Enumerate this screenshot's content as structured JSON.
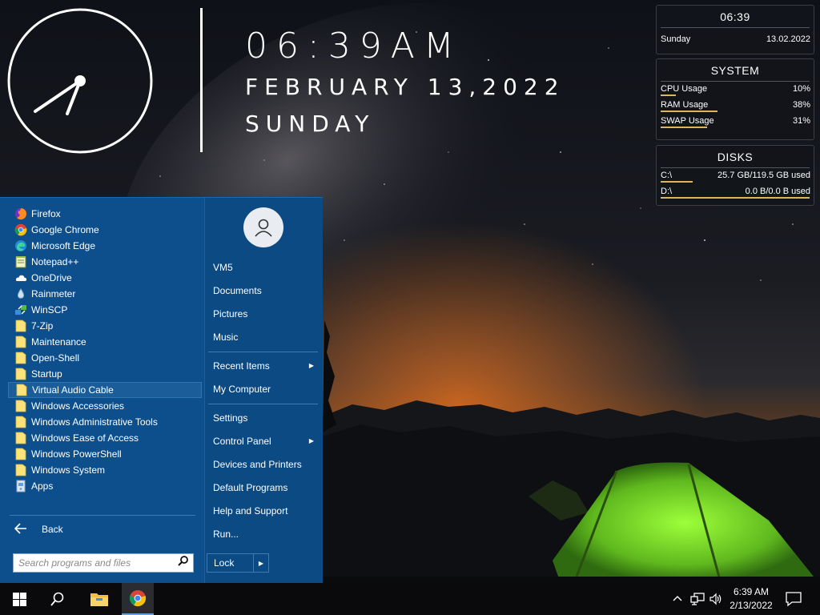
{
  "desktop": {
    "big_time": "06:39AM",
    "big_date": "FEBRUARY 13,2022",
    "big_day": "SUNDAY"
  },
  "widgets": {
    "clock": {
      "time": "06:39",
      "day": "Sunday",
      "date": "13.02.2022"
    },
    "system": {
      "title": "SYSTEM",
      "rows": [
        {
          "label": "CPU Usage",
          "value": "10%",
          "level": 0.1
        },
        {
          "label": "RAM Usage",
          "value": "38%",
          "level": 0.38
        },
        {
          "label": "SWAP Usage",
          "value": "31%",
          "level": 0.31
        }
      ]
    },
    "disks": {
      "title": "DISKS",
      "rows": [
        {
          "label": "C:\\",
          "value": "25.7 GB/119.5 GB used",
          "level": 0.215
        },
        {
          "label": "D:\\",
          "value": "0.0 B/0.0 B used",
          "level": 1.0
        }
      ]
    },
    "accent_color": "#e0b45a"
  },
  "start_menu": {
    "programs": [
      {
        "label": "Firefox",
        "icon": "firefox-icon"
      },
      {
        "label": "Google Chrome",
        "icon": "chrome-icon"
      },
      {
        "label": "Microsoft Edge",
        "icon": "edge-icon"
      },
      {
        "label": "Notepad++",
        "icon": "notepadpp-icon"
      },
      {
        "label": "OneDrive",
        "icon": "onedrive-icon"
      },
      {
        "label": "Rainmeter",
        "icon": "rainmeter-icon"
      },
      {
        "label": "WinSCP",
        "icon": "winscp-icon"
      },
      {
        "label": "7-Zip",
        "icon": "folder-icon"
      },
      {
        "label": "Maintenance",
        "icon": "folder-icon"
      },
      {
        "label": "Open-Shell",
        "icon": "folder-icon"
      },
      {
        "label": "Startup",
        "icon": "folder-icon"
      },
      {
        "label": "Virtual Audio Cable",
        "icon": "folder-icon",
        "selected": true
      },
      {
        "label": "Windows Accessories",
        "icon": "folder-icon"
      },
      {
        "label": "Windows Administrative Tools",
        "icon": "folder-icon"
      },
      {
        "label": "Windows Ease of Access",
        "icon": "folder-icon"
      },
      {
        "label": "Windows PowerShell",
        "icon": "folder-icon"
      },
      {
        "label": "Windows System",
        "icon": "folder-icon"
      },
      {
        "label": "Apps",
        "icon": "apps-icon"
      }
    ],
    "back_label": "Back",
    "search_placeholder": "Search programs and files",
    "places": {
      "user": "VM5",
      "documents": "Documents",
      "pictures": "Pictures",
      "music": "Music",
      "recent_items": "Recent Items",
      "my_computer": "My Computer",
      "settings": "Settings",
      "control_panel": "Control Panel",
      "devices_printers": "Devices and Printers",
      "default_programs": "Default Programs",
      "help_support": "Help and Support",
      "run": "Run..."
    },
    "lock_label": "Lock",
    "background_color": "#0d4f8c"
  },
  "taskbar": {
    "clock_time": "6:39 AM",
    "clock_date": "2/13/2022",
    "pinned": [
      "windows-start-icon",
      "search-icon",
      "file-explorer-icon",
      "chrome-icon"
    ]
  }
}
